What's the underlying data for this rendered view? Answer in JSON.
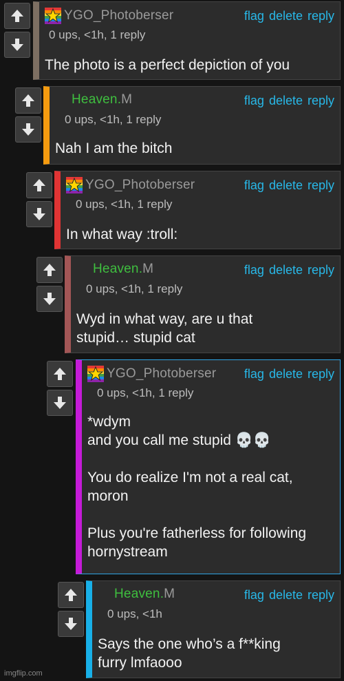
{
  "accent": "#28b8e8",
  "comments": [
    {
      "user": "YGO_Photoberser",
      "mod": "",
      "meta": "0 ups, <1h, 1 reply",
      "text": "The photo is a perfect depiction of you",
      "stripe": "#7d6f62",
      "green": false
    },
    {
      "user": "Heaven.",
      "mod": "M",
      "meta": "0 ups, <1h, 1 reply",
      "text": "Nah I am the bitch",
      "stripe": "#f59b0f",
      "green": true
    },
    {
      "user": "YGO_Photoberser",
      "mod": "",
      "meta": "0 ups, <1h, 1 reply",
      "text": "In what way :troll:",
      "stripe": "#e03434",
      "green": false
    },
    {
      "user": "Heaven.",
      "mod": "M",
      "meta": "0 ups, <1h, 1 reply",
      "text": "Wyd in what way, are u that\nstupid… stupid cat",
      "stripe": "#a35656",
      "green": true
    },
    {
      "user": "YGO_Photoberser",
      "mod": "",
      "meta": "0 ups, <1h, 1 reply",
      "text": "*wdym\nand you call me stupid 💀💀\n\nYou do realize I'm not a real cat,\nmoron\n\nPlus you're fatherless for following\nhornystream",
      "stripe": "#c51bd8",
      "green": false
    },
    {
      "user": "Heaven.",
      "mod": "M",
      "meta": "0 ups, <1h",
      "text": "Says the one who’s a f**king\nfurry lmfaooo",
      "stripe": "#18b0e8",
      "green": true
    }
  ],
  "actions": {
    "flag": "flag",
    "delete": "delete",
    "reply": "reply"
  },
  "icons": {
    "up": "arrow-up-icon",
    "down": "arrow-down-icon",
    "flag": "rainbow-star-flag-icon"
  },
  "watermark": "imgflip.com"
}
